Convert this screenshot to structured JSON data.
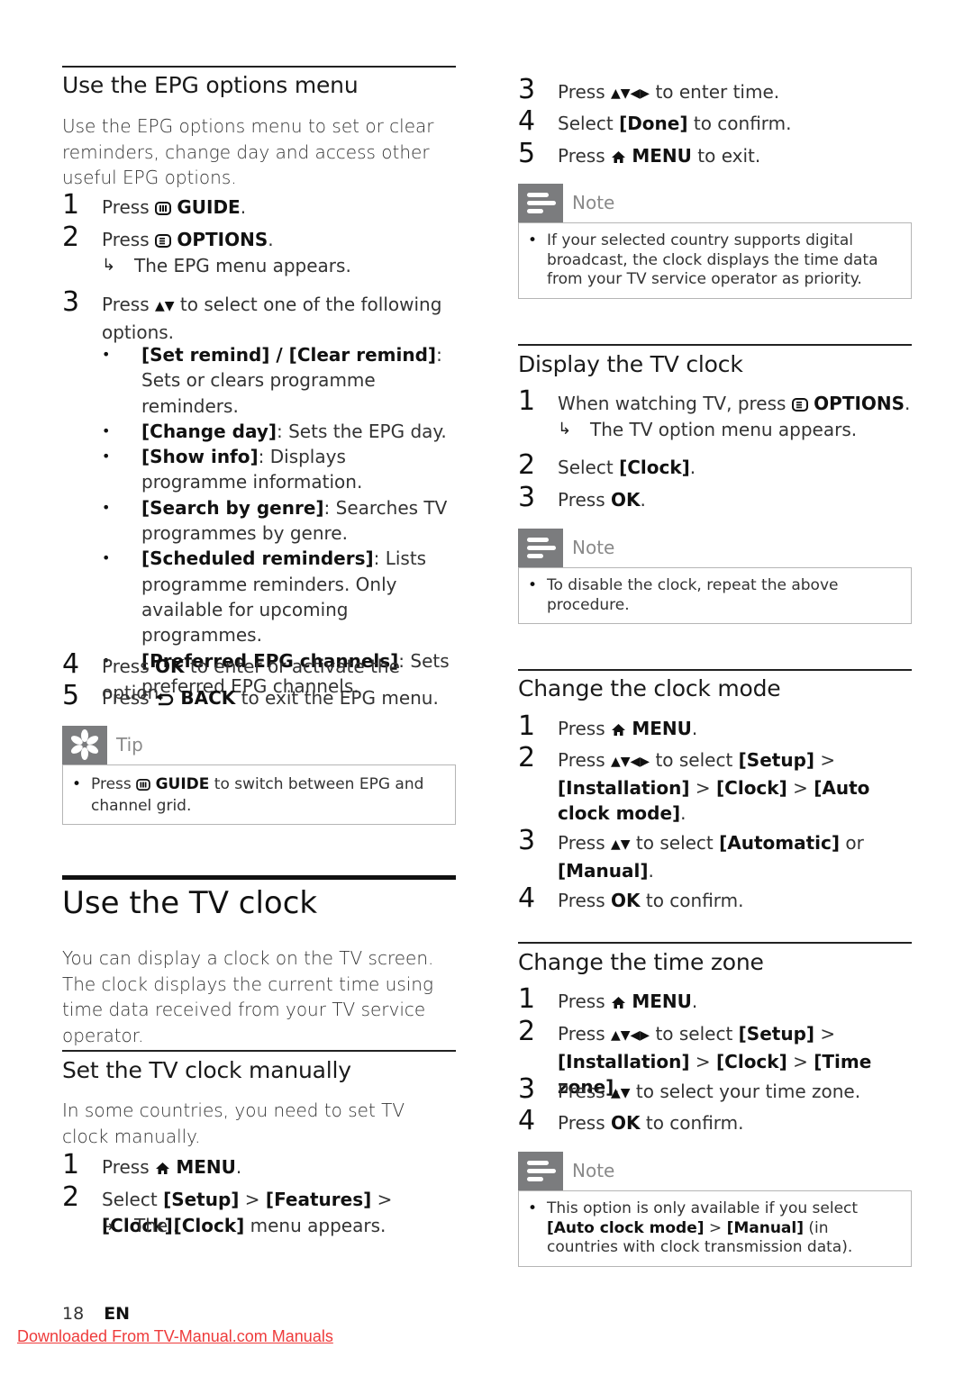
{
  "left": {
    "epg": {
      "title": "Use the EPG options menu",
      "intro": "Use the EPG options menu to set or clear reminders, change day and access other useful EPG options.",
      "steps": [
        {
          "num": "1",
          "pre": "Press",
          "icon": "guide-icon",
          "key": "GUIDE",
          "post": "."
        },
        {
          "num": "2",
          "pre": "Press",
          "icon": "options-icon",
          "key": "OPTIONS",
          "post": ".",
          "result": "The EPG menu appears."
        },
        {
          "num": "3",
          "text_pre": "Press",
          "icon": "up-down-arrows-icon",
          "text_post": "to select one of the following options."
        },
        {
          "num": "4",
          "pre": "Press",
          "key": "OK",
          "post": "to enter or activate the option."
        },
        {
          "num": "5",
          "pre": "Press",
          "icon": "back-icon",
          "key": "BACK",
          "post": "to exit the EPG menu."
        }
      ],
      "options": [
        {
          "label": "[Set remind] / [Clear remind]",
          "desc": ": Sets or clears programme reminders."
        },
        {
          "label": "[Change day]",
          "desc": ": Sets the EPG day."
        },
        {
          "label": "[Show info]",
          "desc": ": Displays programme information."
        },
        {
          "label": "[Search by genre]",
          "desc": ": Searches TV programmes by genre."
        },
        {
          "label": "[Scheduled reminders]",
          "desc": ": Lists programme reminders. Only available for upcoming programmes."
        },
        {
          "label": "[Preferred EPG channels]",
          "desc": ": Sets preferred EPG channels."
        }
      ],
      "tip": {
        "label": "Tip",
        "pre": "Press",
        "key": "GUIDE",
        "post": "to switch between EPG and channel grid."
      }
    },
    "clock": {
      "title": "Use the TV clock",
      "intro": "You can display a clock on the TV screen. The clock displays the current time using time data received from your TV service operator."
    },
    "manual": {
      "title": "Set the TV clock manually",
      "intro": "In some countries, you need to set TV clock manually.",
      "step1": {
        "num": "1",
        "pre": "Press",
        "key": "MENU",
        "post": "."
      },
      "step2": {
        "num": "2",
        "pre": "Select",
        "path": [
          "[Setup]",
          "[Features]",
          "[Clock]"
        ],
        "sep": ">",
        "post": ".",
        "result_pre": "The",
        "result_key": "[Clock]",
        "result_post": "menu appears."
      }
    }
  },
  "right": {
    "manual_cont": {
      "step3": {
        "num": "3",
        "pre": "Press",
        "post": "to enter time."
      },
      "step4": {
        "num": "4",
        "pre": "Select",
        "key": "[Done]",
        "post": "to confirm."
      },
      "step5": {
        "num": "5",
        "pre": "Press",
        "key": "MENU",
        "post": "to exit."
      },
      "note": {
        "label": "Note",
        "text": "If your selected country supports digital broadcast, the clock displays the time data from your TV service operator as priority."
      }
    },
    "display": {
      "title": "Display the TV clock",
      "step1": {
        "num": "1",
        "pre": "When watching TV, press",
        "key": "OPTIONS",
        "post": ".",
        "result": "The TV option menu appears."
      },
      "step2": {
        "num": "2",
        "pre": "Select",
        "key": "[Clock]",
        "post": "."
      },
      "step3": {
        "num": "3",
        "pre": "Press",
        "key": "OK",
        "post": "."
      },
      "note": {
        "label": "Note",
        "text": "To disable the clock, repeat the above procedure."
      }
    },
    "mode": {
      "title": "Change the clock mode",
      "step1": {
        "num": "1",
        "pre": "Press",
        "key": "MENU",
        "post": "."
      },
      "step2": {
        "num": "2",
        "pre": "Press",
        "mid": "to select",
        "k1": "[Setup]",
        "k2": "[Installation]",
        "k3": "[Clock]",
        "k4": "[Auto clock mode]",
        "sep": ">",
        "post": "."
      },
      "step3": {
        "num": "3",
        "pre": "Press",
        "mid": "to select",
        "k1": "[Automatic]",
        "or": "or",
        "k2": "[Manual]",
        "post": "."
      },
      "step4": {
        "num": "4",
        "pre": "Press",
        "key": "OK",
        "post": "to confirm."
      }
    },
    "zone": {
      "title": "Change the time zone",
      "step1": {
        "num": "1",
        "pre": "Press",
        "key": "MENU",
        "post": "."
      },
      "step2": {
        "num": "2",
        "pre": "Press",
        "mid": "to select",
        "k1": "[Setup]",
        "k2": "[Installation]",
        "k3": "[Clock]",
        "k4": "[Time zone]",
        "sep": ">",
        "post": "."
      },
      "step3": {
        "num": "3",
        "pre": "Press",
        "post": "to select your time zone."
      },
      "step4": {
        "num": "4",
        "pre": "Press",
        "key": "OK",
        "post": "to confirm."
      },
      "note": {
        "label": "Note",
        "pre": "This option is only available if you select",
        "k1": "[Auto clock mode]",
        "sep": ">",
        "k2": "[Manual]",
        "post": "(in countries with clock transmission data)."
      }
    }
  },
  "footer": {
    "page_number": "18",
    "language": "EN",
    "download_link": "Downloaded From TV-Manual.com Manuals"
  },
  "colors": {
    "callout_gray": "#7b7c7e",
    "link_red": "#ee3b3b"
  }
}
